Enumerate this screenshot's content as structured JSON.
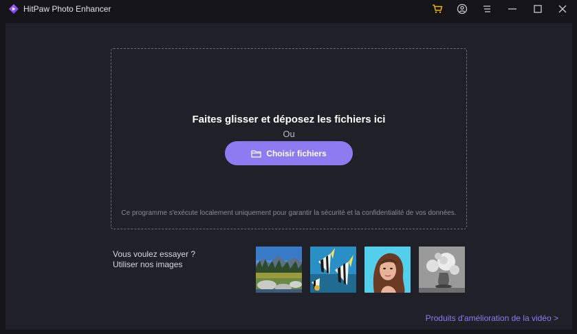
{
  "window": {
    "title": "HitPaw Photo Enhancer"
  },
  "titlebar": {
    "icons": [
      "cart-icon",
      "account-icon",
      "menu-icon",
      "minimize-icon",
      "maximize-icon",
      "close-icon"
    ],
    "accent_color": "#f0b400"
  },
  "dropzone": {
    "title": "Faites glisser et déposez les fichiers ici",
    "or_text": "Ou",
    "choose_button": "Choisir fichiers",
    "privacy_note": "Ce programme s'exécute localement uniquement pour garantir la sécurité et la confidentialité de vos données."
  },
  "samples": {
    "line1": "Vous voulez essayer ?",
    "line2": "Utiliser nos images",
    "images": [
      {
        "name": "landscape-sample"
      },
      {
        "name": "fish-sample"
      },
      {
        "name": "portrait-sample"
      },
      {
        "name": "flowers-sample"
      }
    ]
  },
  "footer": {
    "video_link": "Produits d'amélioration de la vidéo >"
  },
  "colors": {
    "accent": "#8e7bf2",
    "background": "#151519",
    "panel": "#202028"
  }
}
